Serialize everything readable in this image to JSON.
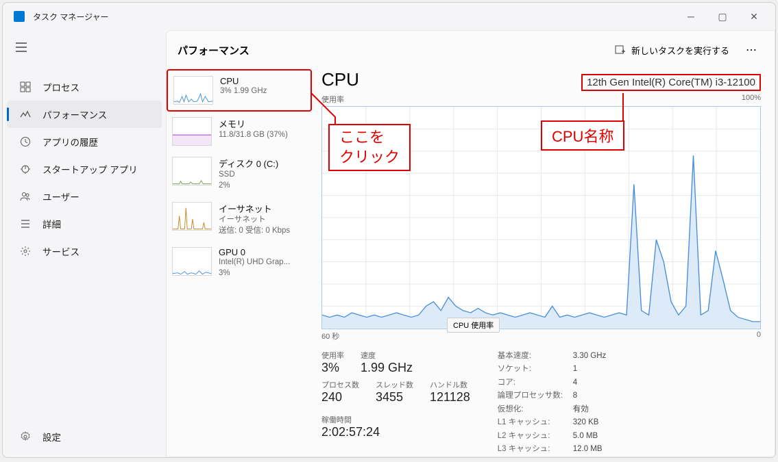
{
  "window": {
    "title": "タスク マネージャー"
  },
  "sidebar": {
    "items": [
      {
        "label": "プロセス",
        "icon": "processes"
      },
      {
        "label": "パフォーマンス",
        "icon": "performance"
      },
      {
        "label": "アプリの履歴",
        "icon": "history"
      },
      {
        "label": "スタートアップ アプリ",
        "icon": "startup"
      },
      {
        "label": "ユーザー",
        "icon": "users"
      },
      {
        "label": "詳細",
        "icon": "details"
      },
      {
        "label": "サービス",
        "icon": "services"
      }
    ],
    "settings": "設定"
  },
  "header": {
    "page_title": "パフォーマンス",
    "new_task": "新しいタスクを実行する"
  },
  "perf_items": [
    {
      "name": "CPU",
      "sub": "3%  1.99 GHz",
      "color": "#4a90d9"
    },
    {
      "name": "メモリ",
      "sub": "11.8/31.8 GB (37%)",
      "color": "#9b3fbf"
    },
    {
      "name": "ディスク 0 (C:)",
      "sub": "SSD\n2%",
      "color": "#6fa84f"
    },
    {
      "name": "イーサネット",
      "sub": "イーサネット\n送信: 0 受信: 0 Kbps",
      "color": "#c58a2a"
    },
    {
      "name": "GPU 0",
      "sub": "Intel(R) UHD Grap...\n3%",
      "color": "#4a90d9"
    }
  ],
  "detail": {
    "title": "CPU",
    "name": "12th Gen Intel(R) Core(TM) i3-12100",
    "top_left": "使用率",
    "top_right": "100%",
    "bot_left": "60 秒",
    "bot_right": "0",
    "tooltip": "CPU 使用率",
    "stats_row1": [
      {
        "label": "使用率",
        "value": "3%"
      },
      {
        "label": "速度",
        "value": "1.99 GHz"
      }
    ],
    "stats_row2": [
      {
        "label": "プロセス数",
        "value": "240"
      },
      {
        "label": "スレッド数",
        "value": "3455"
      },
      {
        "label": "ハンドル数",
        "value": "121128"
      }
    ],
    "uptime": {
      "label": "稼働時間",
      "value": "2:02:57:24"
    },
    "right": [
      {
        "k": "基本速度:",
        "v": "3.30 GHz"
      },
      {
        "k": "ソケット:",
        "v": "1"
      },
      {
        "k": "コア:",
        "v": "4"
      },
      {
        "k": "論理プロセッサ数:",
        "v": "8"
      },
      {
        "k": "仮想化:",
        "v": "有効"
      },
      {
        "k": "L1 キャッシュ:",
        "v": "320 KB"
      },
      {
        "k": "L2 キャッシュ:",
        "v": "5.0 MB"
      },
      {
        "k": "L3 キャッシュ:",
        "v": "12.0 MB"
      }
    ]
  },
  "annotations": {
    "click_here": "ここを\nクリック",
    "cpu_name": "CPU名称"
  },
  "chart_data": {
    "type": "line",
    "title": "CPU 使用率",
    "xlabel": "60 秒",
    "ylabel": "使用率",
    "ylim": [
      0,
      100
    ],
    "x_range_seconds": [
      60,
      0
    ],
    "values": [
      6,
      5,
      6,
      5,
      7,
      6,
      5,
      6,
      5,
      6,
      7,
      6,
      5,
      6,
      10,
      12,
      8,
      14,
      10,
      8,
      7,
      9,
      7,
      6,
      7,
      6,
      5,
      6,
      7,
      6,
      5,
      10,
      5,
      6,
      5,
      6,
      7,
      6,
      5,
      6,
      7,
      6,
      65,
      8,
      6,
      40,
      30,
      12,
      6,
      10,
      78,
      6,
      8,
      35,
      22,
      8,
      5,
      4,
      3,
      3
    ]
  }
}
